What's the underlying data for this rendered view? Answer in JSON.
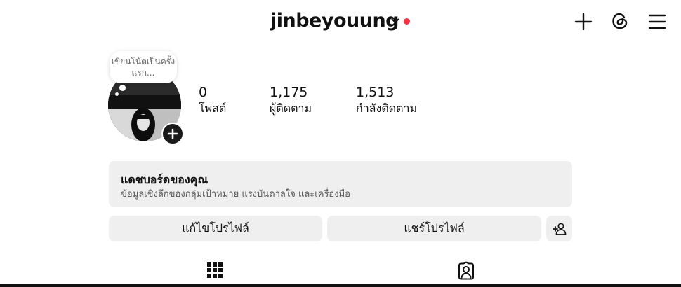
{
  "header": {
    "username": "jinbeyouung"
  },
  "profile": {
    "note_text": "เขียนโน้ตเป็นครั้งแรก...",
    "stats": [
      {
        "value": "0",
        "label": "โพสต์"
      },
      {
        "value": "1,175",
        "label": "ผู้ติดตาม"
      },
      {
        "value": "1,513",
        "label": "กำลังติดตาม"
      }
    ]
  },
  "dashboard": {
    "title": "แดชบอร์ดของคุณ",
    "subtitle": "ข้อมูลเชิงลึกของกลุ่มเป้าหมาย แรงบันดาลใจ และเครื่องมือ"
  },
  "actions": {
    "edit_profile": "แก้ไขโปรไฟล์",
    "share_profile": "แชร์โปรไฟล์"
  },
  "colors": {
    "notification_dot": "#ff3040",
    "button_bg": "#efefef"
  },
  "icons": [
    "chevron-down-icon",
    "plus-icon",
    "threads-icon",
    "menu-icon",
    "add-person-icon",
    "grid-icon",
    "tagged-icon"
  ]
}
